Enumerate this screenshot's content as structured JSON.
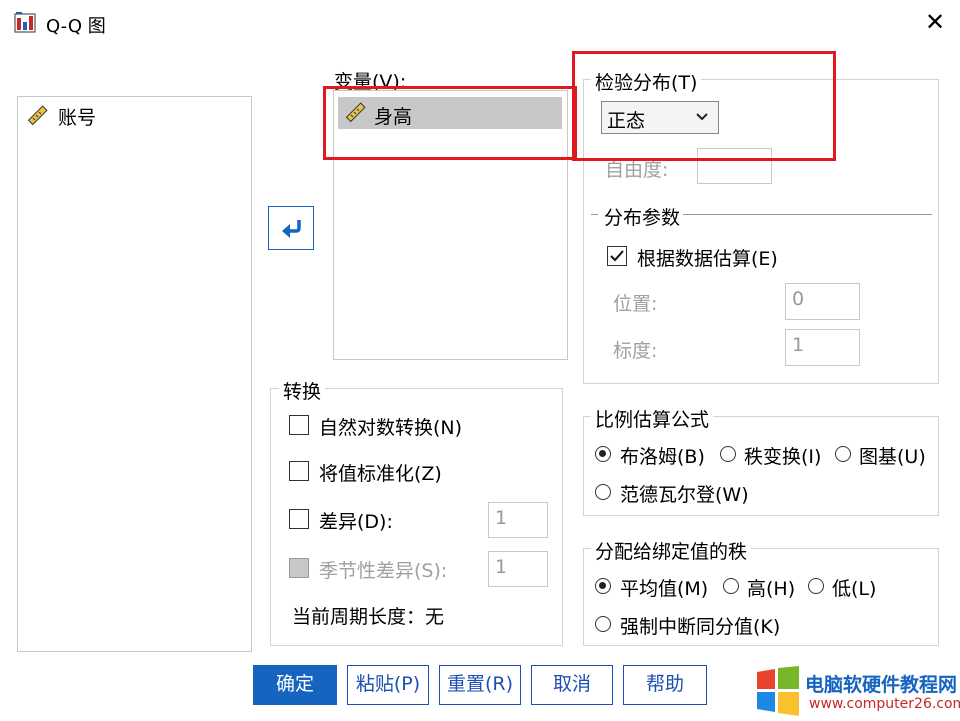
{
  "window": {
    "title": "Q-Q 图",
    "close_glyph": "✕"
  },
  "source_list": {
    "items": [
      {
        "icon": "ruler-icon",
        "label": "账号"
      }
    ]
  },
  "variables": {
    "label": "变量(V):",
    "items": [
      {
        "icon": "ruler-icon",
        "label": "身高"
      }
    ]
  },
  "transform": {
    "title": "转换",
    "natural_log": "自然对数转换(N)",
    "standardize": "将值标准化(Z)",
    "difference": "差异(D):",
    "difference_value": "1",
    "seasonal": "季节性差异(S):",
    "seasonal_value": "1",
    "period": "当前周期长度：无"
  },
  "test_dist": {
    "title": "检验分布(T)",
    "selected": "正态",
    "dof_label": "自由度:",
    "params_title": "分布参数",
    "estimate": "根据数据估算(E)",
    "location_label": "位置:",
    "location_value": "0",
    "scale_label": "标度:",
    "scale_value": "1"
  },
  "proportion": {
    "title": "比例估算公式",
    "options": [
      "布洛姆(B)",
      "秩变换(I)",
      "图基(U)",
      "范德瓦尔登(W)"
    ],
    "selected": "布洛姆(B)"
  },
  "ties": {
    "title": "分配给绑定值的秩",
    "options": [
      "平均值(M)",
      "高(H)",
      "低(L)",
      "强制中断同分值(K)"
    ],
    "selected": "平均值(M)"
  },
  "buttons": {
    "ok": "确定",
    "paste": "粘贴(P)",
    "reset": "重置(R)",
    "cancel": "取消",
    "help": "帮助"
  },
  "watermark": {
    "line1": "电脑软硬件教程网",
    "line2": "www.computer26.com"
  },
  "colors": {
    "accent": "#1565c0",
    "highlight_red": "#e0191e",
    "selected_row": "#c8c8c8"
  }
}
